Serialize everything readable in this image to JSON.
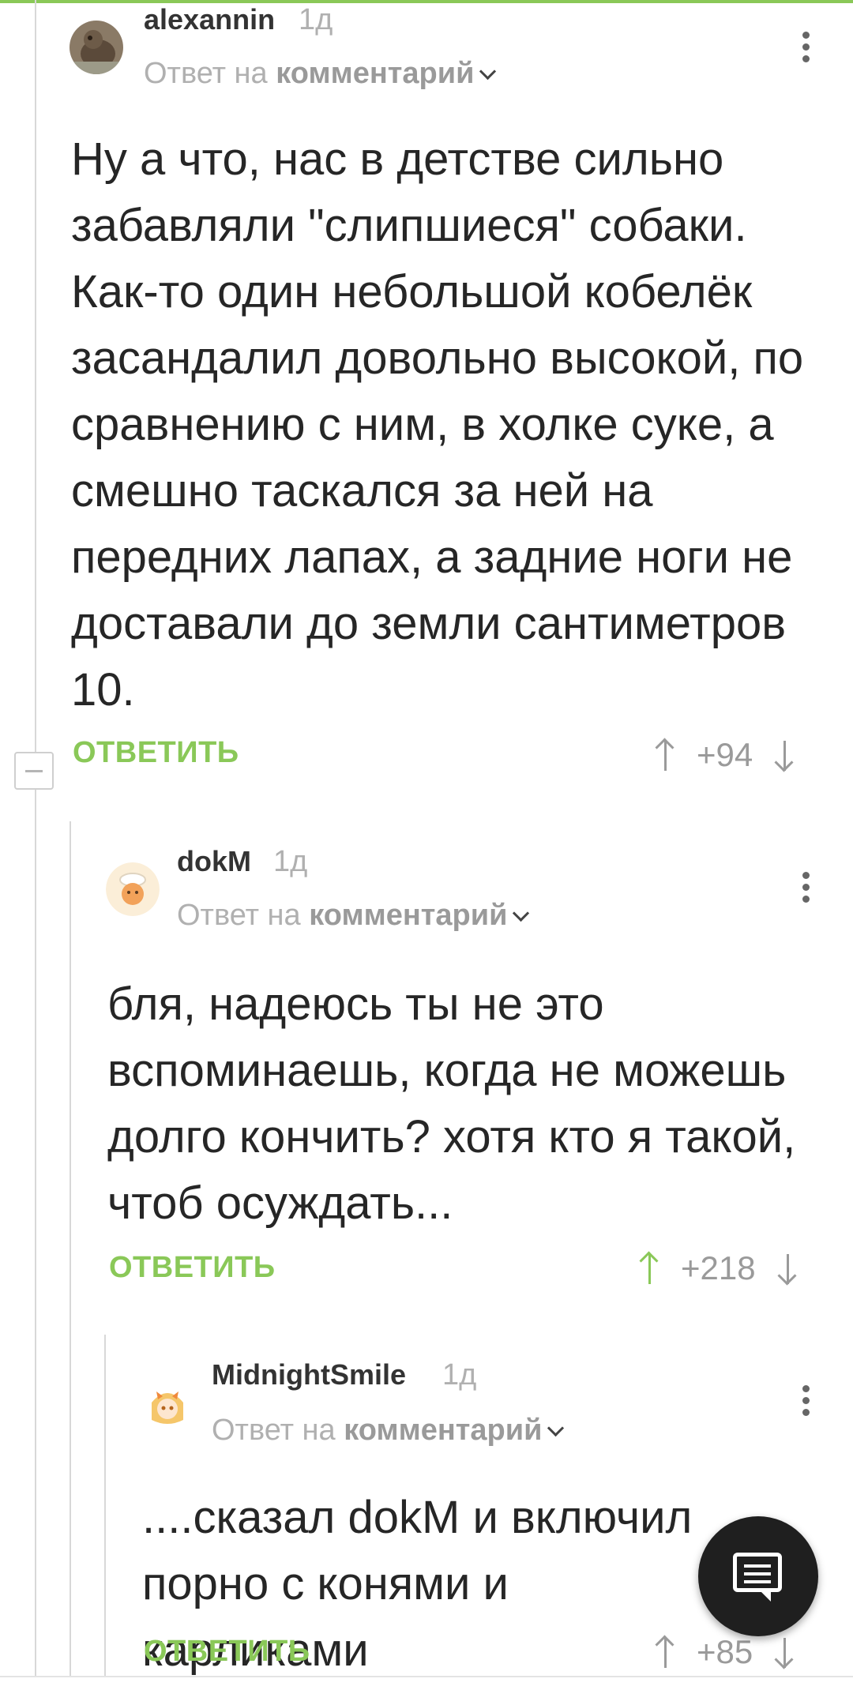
{
  "comments": [
    {
      "username": "alexannin",
      "time": "1д",
      "reply_prefix": "Ответ на",
      "reply_target": "комментарий",
      "text": "Ну а что, нас в детстве сильно забавляли \"слипшиеся\" собаки. Как-то один небольшой кобелёк засандалил довольно высокой, по сравнению с ним, в холке суке, а смешно таскался за ней на передних лапах, а задние ноги не доставали до земли сантиметров 10.",
      "reply_label": "ОТВЕТИТЬ",
      "score": "+94"
    },
    {
      "username": "dokM",
      "time": "1д",
      "reply_prefix": "Ответ на",
      "reply_target": "комментарий",
      "text": "бля, надеюсь ты не это вспоминаешь, когда не можешь долго кончить? хотя кто я такой, чтоб осуждать...",
      "reply_label": "ОТВЕТИТЬ",
      "score": "+218"
    },
    {
      "username": "MidnightSmile",
      "time": "1д",
      "reply_prefix": "Ответ на",
      "reply_target": "комментарий",
      "text": "....сказал dokM и включил порно с конями и карликами",
      "reply_label": "ОТВЕТИТЬ",
      "score": "+85"
    }
  ],
  "colors": {
    "accent": "#8ac858",
    "muted": "#b0b0b0",
    "fab": "#1f1f1f"
  },
  "icons": [
    "avatar",
    "kebab-menu-icon",
    "chevron-down-icon",
    "upvote-arrow-icon",
    "downvote-arrow-icon",
    "collapse-thread-icon",
    "comment-fab-icon"
  ]
}
